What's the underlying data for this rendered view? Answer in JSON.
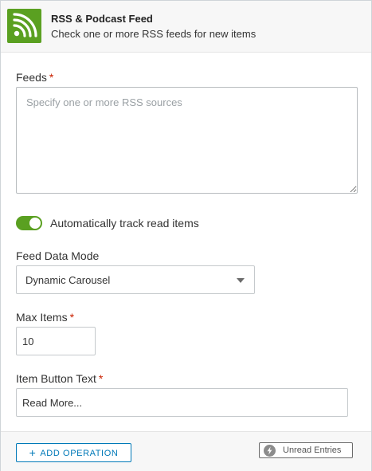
{
  "header": {
    "title": "RSS & Podcast Feed",
    "subtitle": "Check one or more RSS feeds for new items",
    "icon": "rss-icon",
    "icon_color": "#5aa021"
  },
  "form": {
    "feeds": {
      "label": "Feeds",
      "required": "*",
      "placeholder": "Specify one or more RSS sources",
      "value": ""
    },
    "track_read": {
      "label": "Automatically track read items",
      "enabled": true
    },
    "feed_data_mode": {
      "label": "Feed Data Mode",
      "selected": "Dynamic Carousel"
    },
    "max_items": {
      "label": "Max Items",
      "required": "*",
      "value": "10"
    },
    "item_button_text": {
      "label": "Item Button Text",
      "required": "*",
      "value": "Read More..."
    }
  },
  "footer": {
    "add_operation_plus": "+",
    "add_operation_label": "ADD OPERATION",
    "badge_icon": "lightning-icon",
    "badge_label": "Unread Entries"
  },
  "colors": {
    "accent": "#5aa021",
    "link": "#0079b8",
    "required": "#c92100"
  }
}
